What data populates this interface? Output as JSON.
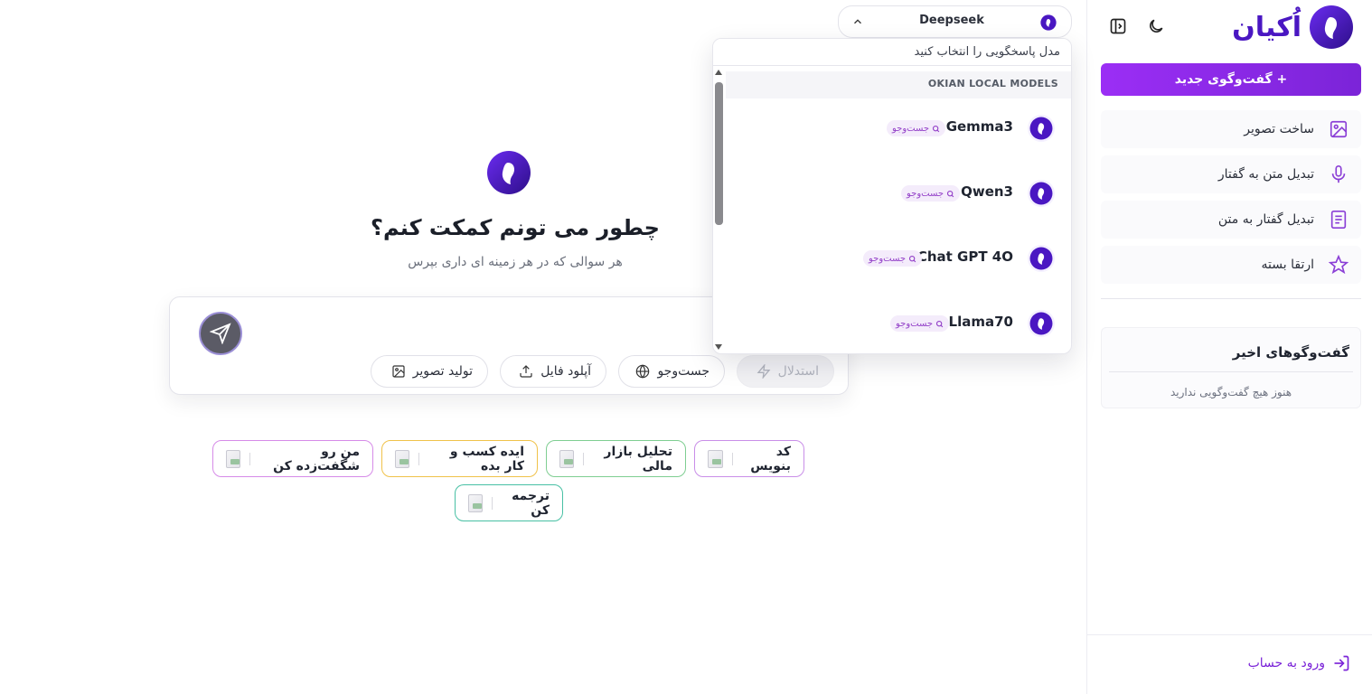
{
  "brand": {
    "logo_text": "اُکیان",
    "accent": "#7b24d8",
    "accent_dark": "#4a17c2"
  },
  "header": {
    "theme_toggle_icon": "moon-icon",
    "sidebar_toggle_icon": "sidebar-collapse-icon",
    "model_select": {
      "label": "Deepseek"
    }
  },
  "sidebar": {
    "new_chat_label": "+ گفت‌وگوی جدید",
    "items": [
      {
        "label": "ساخت تصویر",
        "icon": "image-icon"
      },
      {
        "label": "تبدیل متن به گفتار",
        "icon": "microphone-icon"
      },
      {
        "label": "تبدیل گفتار به متن",
        "icon": "document-icon"
      },
      {
        "label": "ارتقا بسته",
        "icon": "star-icon"
      }
    ],
    "recent_title": "گفت‌وگوهای اخیر",
    "recent_empty": "هنوز هیچ گفت‌وگویی ندارید",
    "login_label": "ورود به حساب"
  },
  "main": {
    "headline": "چطور می تونم کمکت کنم؟",
    "subline": "هر سوالی که در هر زمینه ای داری بپرس",
    "composer": {
      "placeholder": "",
      "tools": [
        {
          "label": "استدلال",
          "icon": "bolt-icon",
          "disabled": true
        },
        {
          "label": "جست‌وجو",
          "icon": "globe-icon",
          "disabled": false
        },
        {
          "label": "آپلود فایل",
          "icon": "upload-icon",
          "disabled": false
        },
        {
          "label": "تولید تصویر",
          "icon": "image-icon",
          "disabled": false
        }
      ]
    },
    "chips": [
      {
        "label": "کد بنویس",
        "color": "#c98ee8"
      },
      {
        "label": "تحلیل بازار مالی",
        "color": "#7fce92"
      },
      {
        "label": "ایده کسب و کار بده",
        "color": "#f0c24a"
      },
      {
        "label": "من رو شگفت‌زده کن",
        "color": "#d68be8"
      },
      {
        "label": "ترجمه کن",
        "color": "#48c0a4"
      }
    ]
  },
  "model_dropdown": {
    "search_placeholder": "مدل پاسخگویی را انتخاب کنید",
    "group_label": "OKIAN LOCAL MODELS",
    "badge_label": "جست‌وجو",
    "models": [
      {
        "name": "Gemma3"
      },
      {
        "name": "Qwen3"
      },
      {
        "name": "Chat GPT 4O"
      },
      {
        "name": "Llama70"
      }
    ]
  }
}
